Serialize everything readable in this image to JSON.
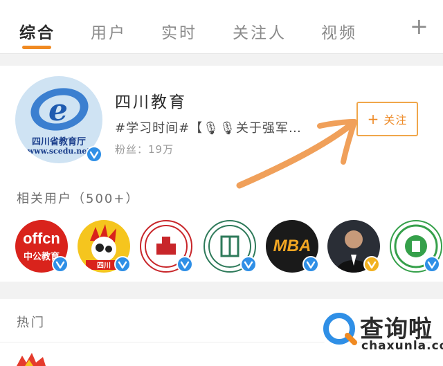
{
  "tabs": [
    {
      "label": "综合",
      "active": true
    },
    {
      "label": "用户",
      "active": false
    },
    {
      "label": "实时",
      "active": false
    },
    {
      "label": "关注人",
      "active": false
    },
    {
      "label": "视频",
      "active": false
    }
  ],
  "tab_add_icon": "plus-icon",
  "top_user": {
    "avatar_text_line1": "四川省教育厅",
    "avatar_text_line2": "www.scedu.net",
    "name": "四川教育",
    "description": "#学习时间#【🎙🎙关于强军…",
    "fans": "粉丝：19万",
    "follow_label": "关注",
    "follow_icon": "plus-icon",
    "verified_icon": "verified-badge-icon"
  },
  "related": {
    "label": "相关用户（500+）",
    "avatars": [
      {
        "text": "offcn",
        "subtext": "中公教育",
        "badge": "blue"
      },
      {
        "text": "",
        "subtext": "四川",
        "badge": "blue"
      },
      {
        "text": "",
        "subtext": "",
        "badge": "blue"
      },
      {
        "text": "",
        "subtext": "",
        "badge": "blue"
      },
      {
        "text": "MBA",
        "subtext": "",
        "badge": "blue"
      },
      {
        "text": "",
        "subtext": "",
        "badge": "gold"
      },
      {
        "text": "",
        "subtext": "",
        "badge": "blue"
      }
    ]
  },
  "hot": {
    "label": "热门"
  },
  "watermark": {
    "title": "查询啦",
    "url": "chaxunla.com"
  },
  "colors": {
    "accent": "#f08a22",
    "follow": "#ee8a26",
    "verified": "#2f8fe6",
    "annotation_arrow": "#f0a05a"
  }
}
